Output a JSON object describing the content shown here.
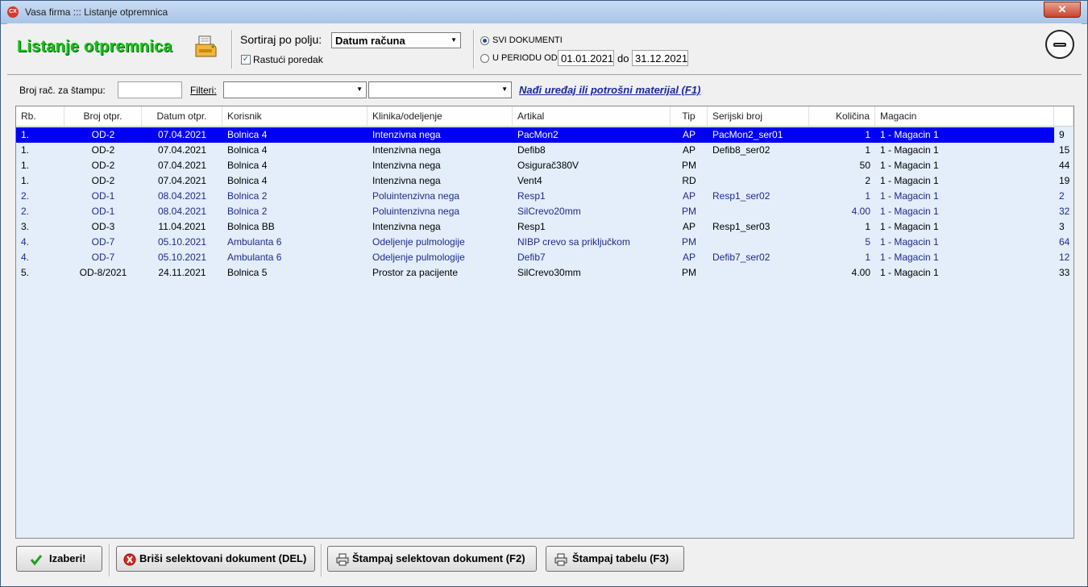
{
  "window": {
    "title": "Vasa firma ::: Listanje otpremnica",
    "close_label": "✕"
  },
  "header": {
    "heading": "Listanje otpremnica",
    "sort_label": "Sortiraj po polju:",
    "sort_value": "Datum računa",
    "ascending_label": "Rastući poredak",
    "ascending_checked": true,
    "all_docs_label": "SVI DOKUMENTI",
    "period_label": "U PERIODU OD:",
    "date_from": "01.01.2021",
    "to_label": "do",
    "date_to": "31.12.2021"
  },
  "filters": {
    "print_no_label": "Broj rač. za štampu:",
    "print_no_value": "",
    "filters_label": "Filteri:",
    "filter1_value": "",
    "filter2_value": "",
    "find_link": "Nađi uređaj ili potrošni materijal (F1)"
  },
  "table": {
    "columns": [
      "Rb.",
      "Broj otpr.",
      "Datum otpr.",
      "Korisnik",
      "Klinika/odeljenje",
      "Artikal",
      "Tip",
      "Serijski broj",
      "Količina",
      "Magacin"
    ],
    "rows": [
      {
        "rb": "1.",
        "broj": "OD-2",
        "datum": "07.04.2021",
        "korisnik": "Bolnica 4",
        "klinika": "Intenzivna nega",
        "artikal": "PacMon2",
        "tip": "AP",
        "serijski": "PacMon2_ser01",
        "kolicina": "1",
        "magacin": "1 - Magacin 1",
        "extra": "9",
        "style": "sel"
      },
      {
        "rb": "1.",
        "broj": "OD-2",
        "datum": "07.04.2021",
        "korisnik": "Bolnica 4",
        "klinika": "Intenzivna nega",
        "artikal": "Defib8",
        "tip": "AP",
        "serijski": "Defib8_ser02",
        "kolicina": "1",
        "magacin": "1 - Magacin 1",
        "extra": "15",
        "style": "black"
      },
      {
        "rb": "1.",
        "broj": "OD-2",
        "datum": "07.04.2021",
        "korisnik": "Bolnica 4",
        "klinika": "Intenzivna nega",
        "artikal": "Osigurač380V",
        "tip": "PM",
        "serijski": "",
        "kolicina": "50",
        "magacin": "1 - Magacin 1",
        "extra": "44",
        "style": "black"
      },
      {
        "rb": "1.",
        "broj": "OD-2",
        "datum": "07.04.2021",
        "korisnik": "Bolnica 4",
        "klinika": "Intenzivna nega",
        "artikal": "Vent4",
        "tip": "RD",
        "serijski": "",
        "kolicina": "2",
        "magacin": "1 - Magacin 1",
        "extra": "19",
        "style": "black"
      },
      {
        "rb": "2.",
        "broj": "OD-1",
        "datum": "08.04.2021",
        "korisnik": "Bolnica 2",
        "klinika": "Poluintenzivna nega",
        "artikal": "Resp1",
        "tip": "AP",
        "serijski": "Resp1_ser02",
        "kolicina": "1",
        "magacin": "1 - Magacin 1",
        "extra": "2",
        "style": "blue"
      },
      {
        "rb": "2.",
        "broj": "OD-1",
        "datum": "08.04.2021",
        "korisnik": "Bolnica 2",
        "klinika": "Poluintenzivna nega",
        "artikal": "SilCrevo20mm",
        "tip": "PM",
        "serijski": "",
        "kolicina": "4.00",
        "magacin": "1 - Magacin 1",
        "extra": "32",
        "style": "blue"
      },
      {
        "rb": "3.",
        "broj": "OD-3",
        "datum": "11.04.2021",
        "korisnik": "Bolnica BB",
        "klinika": "Intenzivna nega",
        "artikal": "Resp1",
        "tip": "AP",
        "serijski": "Resp1_ser03",
        "kolicina": "1",
        "magacin": "1 - Magacin 1",
        "extra": "3",
        "style": "black"
      },
      {
        "rb": "4.",
        "broj": "OD-7",
        "datum": "05.10.2021",
        "korisnik": "Ambulanta 6",
        "klinika": "Odeljenje pulmologije",
        "artikal": "NIBP crevo sa priključkom",
        "tip": "PM",
        "serijski": "",
        "kolicina": "5",
        "magacin": "1 - Magacin 1",
        "extra": "64",
        "style": "blue"
      },
      {
        "rb": "4.",
        "broj": "OD-7",
        "datum": "05.10.2021",
        "korisnik": "Ambulanta 6",
        "klinika": "Odeljenje pulmologije",
        "artikal": "Defib7",
        "tip": "AP",
        "serijski": "Defib7_ser02",
        "kolicina": "1",
        "magacin": "1 - Magacin 1",
        "extra": "12",
        "style": "blue"
      },
      {
        "rb": "5.",
        "broj": "OD-8/2021",
        "datum": "24.11.2021",
        "korisnik": "Bolnica 5",
        "klinika": "Prostor za pacijente",
        "artikal": "SilCrevo30mm",
        "tip": "PM",
        "serijski": "",
        "kolicina": "4.00",
        "magacin": "1 - Magacin 1",
        "extra": "33",
        "style": "black"
      }
    ]
  },
  "footer": {
    "select_label": "Izaberi!",
    "delete_label": "Briši selektovani dokument (DEL)",
    "print_doc_label": "Štampaj selektovan dokument (F2)",
    "print_table_label": "Štampaj tabelu (F3)"
  },
  "colors": {
    "selected_row": "#0000f6",
    "heading_green": "#16c416",
    "blue_row_text": "#1e2a8e",
    "grid_bg": "#e3eefa"
  },
  "icons": [
    "app-icon",
    "printer-icon",
    "checkmark-icon",
    "delete-icon",
    "print-icon",
    "minimize-icon",
    "chevron-down-icon"
  ]
}
